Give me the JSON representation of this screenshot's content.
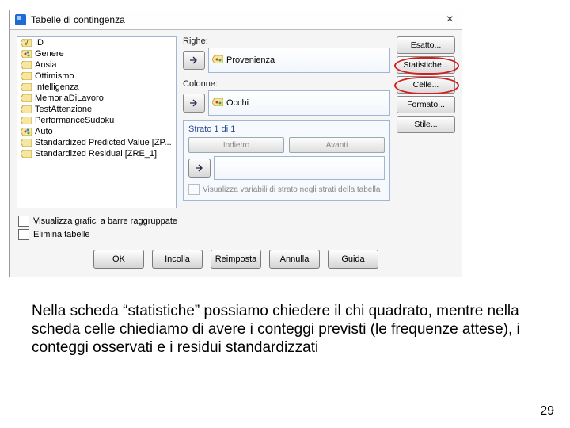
{
  "dialog": {
    "title": "Tabelle di contingenza",
    "close_glyph": "×",
    "variables": [
      {
        "icon": "scale",
        "label": "ID"
      },
      {
        "icon": "nominal",
        "label": "Genere"
      },
      {
        "icon": "scale",
        "label": "Ansia"
      },
      {
        "icon": "scale",
        "label": "Ottimismo"
      },
      {
        "icon": "scale",
        "label": "Intelligenza"
      },
      {
        "icon": "scale",
        "label": "MemoriaDiLavoro"
      },
      {
        "icon": "scale",
        "label": "TestAttenzione"
      },
      {
        "icon": "scale",
        "label": "PerformanceSudoku"
      },
      {
        "icon": "nominal",
        "label": "Auto"
      },
      {
        "icon": "scale",
        "label": "Standardized Predicted Value [ZP..."
      },
      {
        "icon": "scale",
        "label": "Standardized Residual [ZRE_1]"
      }
    ],
    "righe_label": "Righe:",
    "righe_value": "Provenienza",
    "colonne_label": "Colonne:",
    "colonne_value": "Occhi",
    "strata_title": "Strato 1 di 1",
    "strata_prev": "Indietro",
    "strata_next": "Avanti",
    "strata_check": "Visualizza variabili di strato negli strati della tabella",
    "right_buttons": {
      "esatto": "Esatto...",
      "statistiche": "Statistiche...",
      "celle": "Celle...",
      "formato": "Formato...",
      "stile": "Stile..."
    },
    "checks": {
      "bars": "Visualizza grafici a barre raggruppate",
      "suppress": "Elimina tabelle"
    },
    "actions": {
      "ok": "OK",
      "incolla": "Incolla",
      "reimposta": "Reimposta",
      "annulla": "Annulla",
      "guida": "Guida"
    }
  },
  "caption": "Nella scheda “statistiche” possiamo chiedere il chi quadrato, mentre nella scheda celle chiediamo di avere i conteggi previsti (le frequenze attese), i conteggi  osservati e i residui standardizzati",
  "page": "29"
}
